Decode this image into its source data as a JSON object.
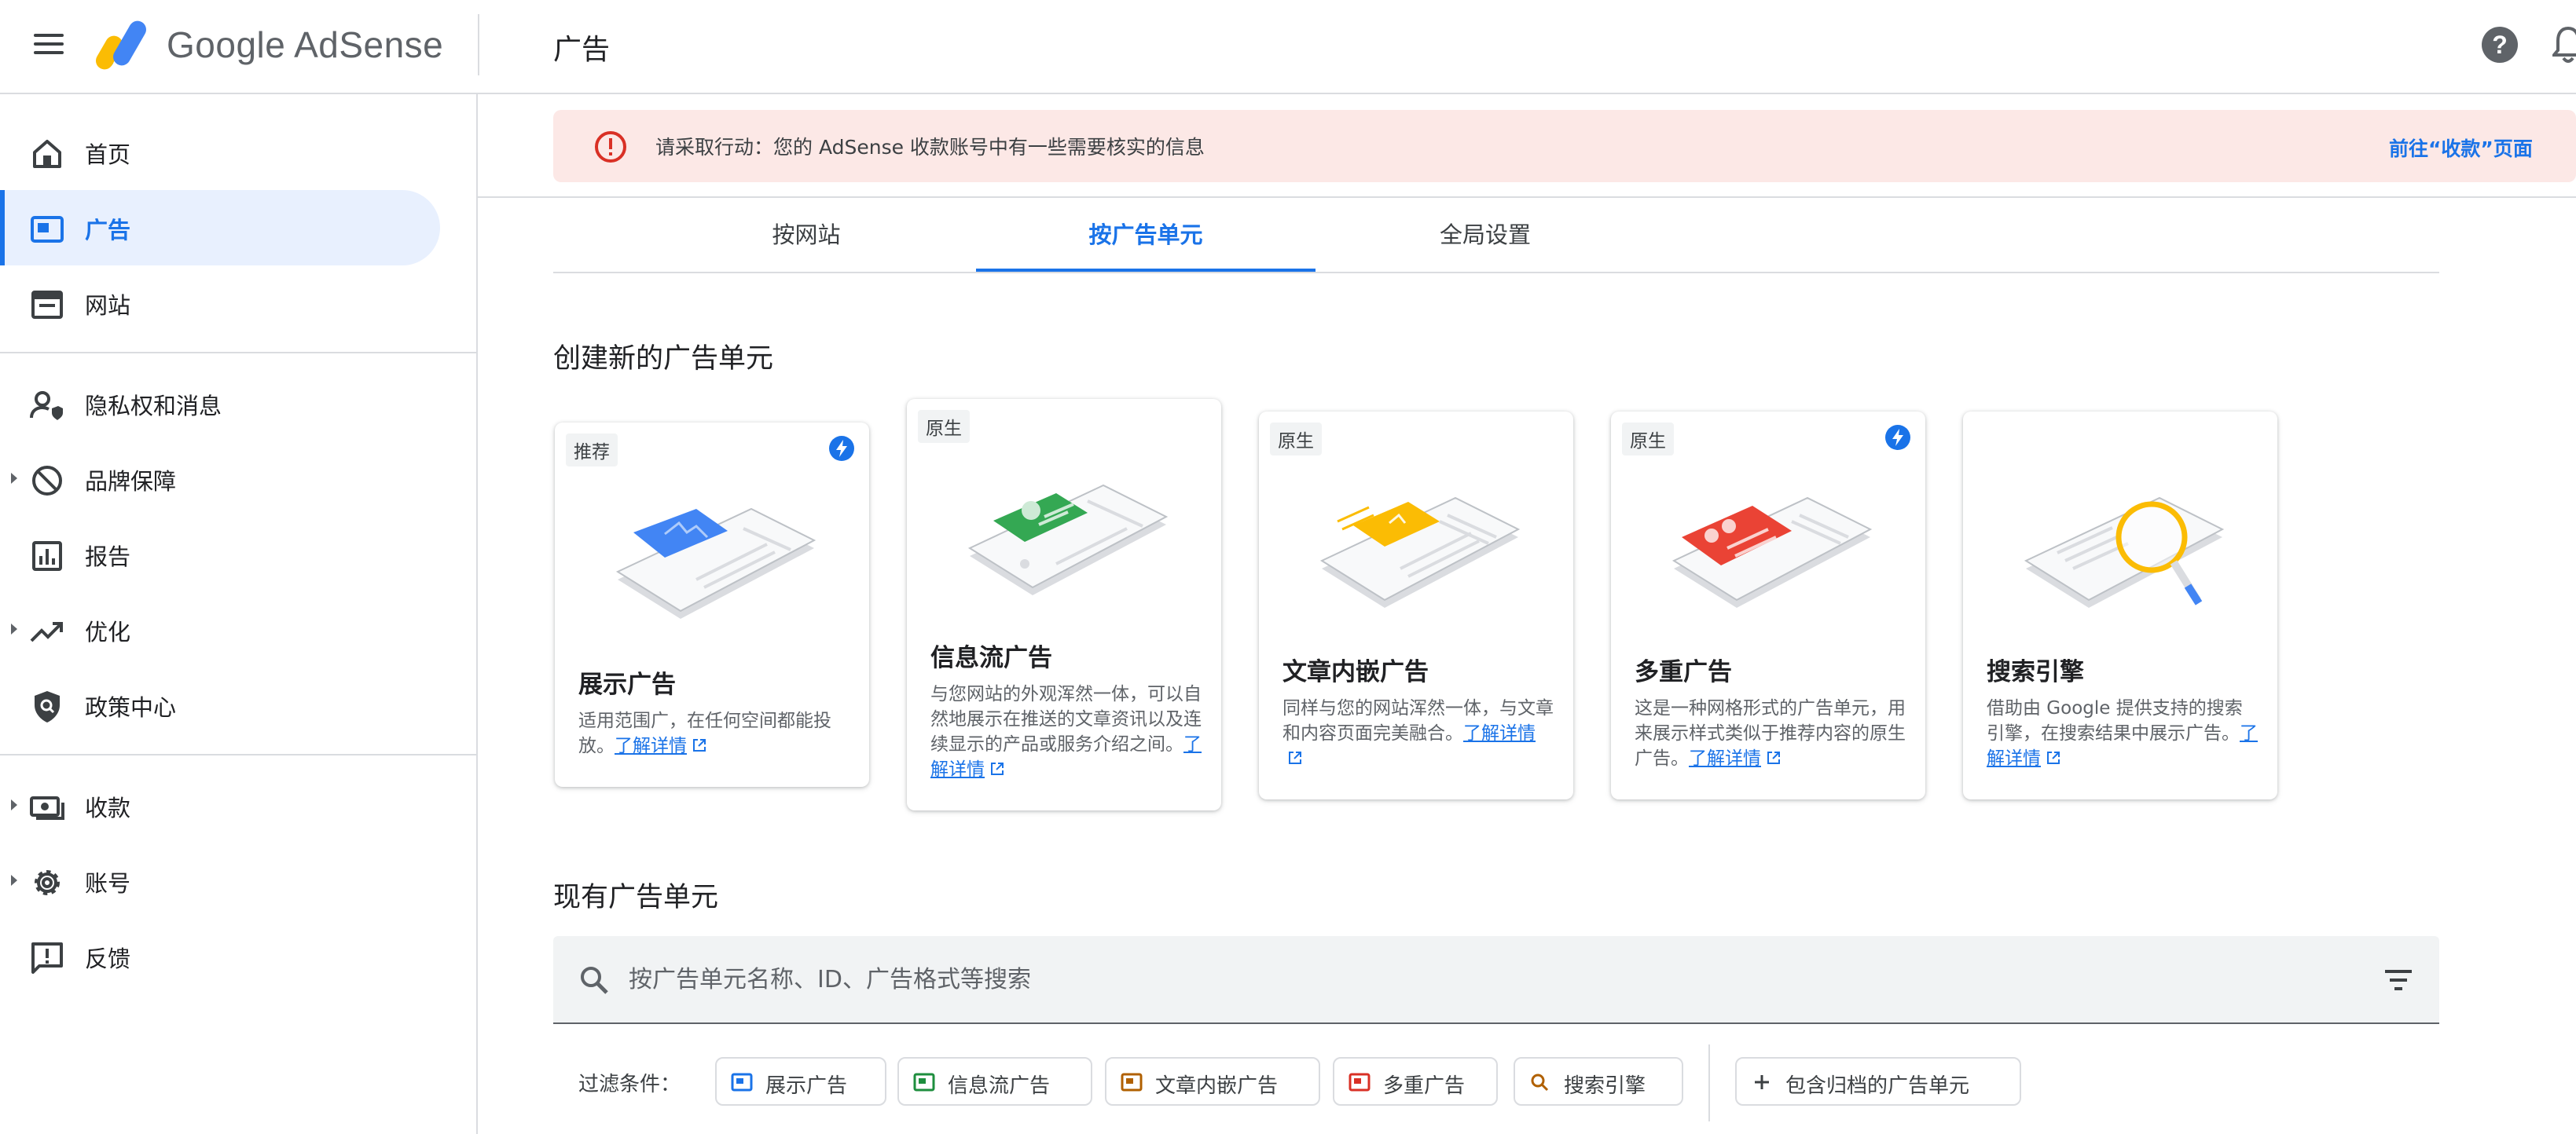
{
  "header": {
    "brand": "Google AdSense",
    "page_title": "广告"
  },
  "sidebar": {
    "items": [
      {
        "label": "首页"
      },
      {
        "label": "广告"
      },
      {
        "label": "网站"
      },
      {
        "label": "隐私权和消息"
      },
      {
        "label": "品牌保障"
      },
      {
        "label": "报告"
      },
      {
        "label": "优化"
      },
      {
        "label": "政策中心"
      },
      {
        "label": "收款"
      },
      {
        "label": "账号"
      },
      {
        "label": "反馈"
      }
    ]
  },
  "alert": {
    "text": "请采取行动：您的 AdSense 收款账号中有一些需要核实的信息",
    "link": "前往“收款”页面"
  },
  "tabs": [
    {
      "label": "按网站"
    },
    {
      "label": "按广告单元"
    },
    {
      "label": "全局设置"
    }
  ],
  "create_section": {
    "title": "创建新的广告单元",
    "cards": [
      {
        "tag": "推荐",
        "title": "展示广告",
        "desc": "适用范围广，在任何空间都能投放。",
        "link": "了解详情"
      },
      {
        "tag": "原生",
        "title": "信息流广告",
        "desc": "与您网站的外观浑然一体，可以自然地展示在推送的文章资讯以及连续显示的产品或服务介绍之间。",
        "link": "了解详情"
      },
      {
        "tag": "原生",
        "title": "文章内嵌广告",
        "desc": "同样与您的网站浑然一体，与文章和内容页面完美融合。",
        "link": "了解详情"
      },
      {
        "tag": "原生",
        "title": "多重广告",
        "desc": "这是一种网格形式的广告单元，用来展示样式类似于推荐内容的原生广告。",
        "link": "了解详情"
      },
      {
        "title": "搜索引擎",
        "desc": "借助由 Google 提供支持的搜索引擎，在搜索结果中展示广告。",
        "link": "了解详情"
      }
    ]
  },
  "existing_section": {
    "title": "现有广告单元",
    "search_placeholder": "按广告单元名称、ID、广告格式等搜索"
  },
  "filters": {
    "label": "过滤条件：",
    "chips": [
      {
        "label": "展示广告",
        "color": "#1a73e8"
      },
      {
        "label": "信息流广告",
        "color": "#1e8e3e"
      },
      {
        "label": "文章内嵌广告",
        "color": "#b06000"
      },
      {
        "label": "多重广告",
        "color": "#d93025"
      },
      {
        "label": "搜索引擎",
        "color": "#b06000"
      }
    ],
    "archived": "包含归档的广告单元"
  },
  "colors": {
    "accent": "#1a73e8",
    "alert_bg": "#fce8e6",
    "active_nav_bg": "#e8f0fe"
  }
}
